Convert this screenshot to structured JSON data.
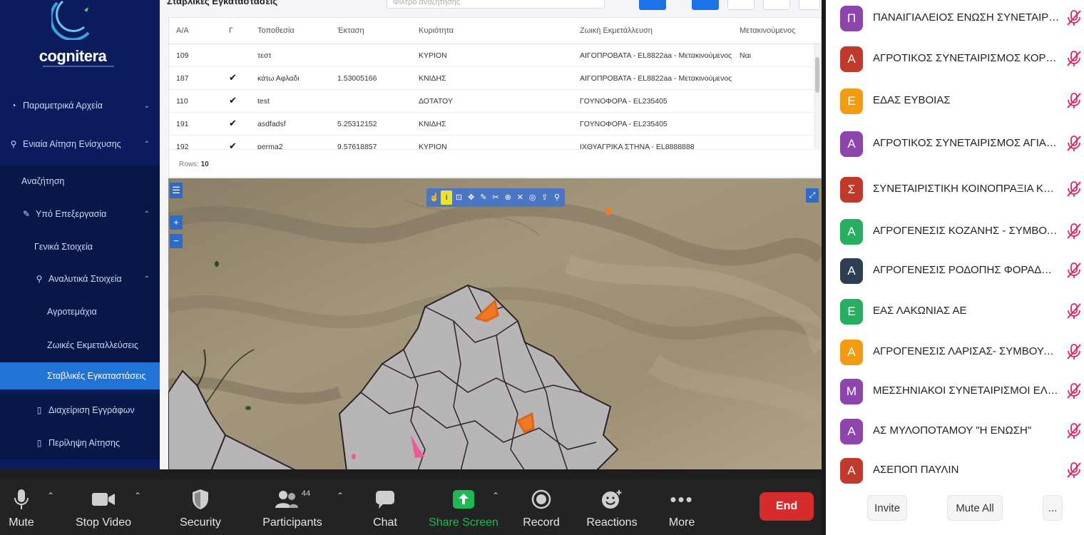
{
  "app": {
    "logo_text": "cognitera",
    "nav": [
      {
        "label": "Παραμετρικά Αρχεία",
        "icon": "settings-icon"
      },
      {
        "label": "Ενιαία Αίτηση Ενίσχυσης",
        "icon": "user-icon"
      },
      {
        "label": "Αναζήτηση"
      },
      {
        "label": "Υπό Επεξεργασία",
        "icon": "pencil-icon"
      },
      {
        "label": "Γενικά Στοιχεία"
      },
      {
        "label": "Αναλυτικά Στοιχεία",
        "icon": "user-icon"
      },
      {
        "label": "Αγροτεμάχια"
      },
      {
        "label": "Ζωικές Εκμεταλλεύσεις"
      },
      {
        "label": "Σταβλικές Εγκαταστάσεις"
      },
      {
        "label": "Διαχείριση Εγγράφων",
        "icon": "document-icon"
      },
      {
        "label": "Περίληψη Αίτησης",
        "icon": "document-icon"
      }
    ],
    "main_title": "Σταβλικές Εγκαταστάσεις",
    "filter_placeholder": "Φίλτρο αναζήτησης",
    "grid": {
      "columns": [
        "Α/Α",
        "Γ",
        "Τοποθεσία",
        "Έκταση",
        "Κυριότητα",
        "Ζωική Εκμετάλλευση",
        "Μετακινούμενος"
      ],
      "rows": [
        {
          "aa": "109",
          "g": "",
          "topo": "τεστ",
          "ektasi": "",
          "kyr": "ΚΥΡΙΟΝ",
          "zoiki": "ΑΙΓΟΠΡΟΒΑΤΑ - EL8822aa - Μετακινούμενος",
          "met": "Ναι"
        },
        {
          "aa": "187",
          "g": "✔",
          "topo": "κάτω Αφλαδι",
          "ektasi": "1.53005166",
          "kyr": "ΚΝΙΔΗΣ",
          "zoiki": "ΑΙΓΟΠΡΟΒΑΤΑ - EL8822aa - Μετακινούμενος",
          "met": ""
        },
        {
          "aa": "110",
          "g": "✔",
          "topo": "test",
          "ektasi": "",
          "kyr": "ΔΟΤΑΤΟΥ",
          "zoiki": "ΓΟΥΝΟΦΟΡΑ - EL235405",
          "met": ""
        },
        {
          "aa": "191",
          "g": "✔",
          "topo": "asdfadsf",
          "ektasi": "5.25312152",
          "kyr": "ΚΝΙΔΗΣ",
          "zoiki": "ΓΟΥΝΟΦΟΡΑ - EL235405",
          "met": ""
        },
        {
          "aa": "192",
          "g": "✔",
          "topo": "perma2",
          "ektasi": "9.57618857",
          "kyr": "ΚΥΡΙΟΝ",
          "zoiki": "ΙΧΘΥΑΓΡΙΚΑ ΣΤΗΝΑ - EL8888888",
          "met": ""
        }
      ],
      "footer_label": "Rows:",
      "footer_count": "10"
    }
  },
  "zoom": {
    "controls": {
      "mute": "Mute",
      "stop_video": "Stop Video",
      "security": "Security",
      "participants": "Participants",
      "participants_count": "44",
      "chat": "Chat",
      "share_screen": "Share Screen",
      "record": "Record",
      "reactions": "Reactions",
      "more": "More",
      "end": "End"
    },
    "participants": [
      {
        "initial": "Π",
        "name": "ΠΑΝΑΙΓΙΑΛΕΙΟΣ ΕΝΩΣΗ ΣΥΝΕΤΑΙΡΙΣ...",
        "color": "#8e44ad"
      },
      {
        "initial": "Α",
        "name": "ΑΓΡΟΤΙΚΟΣ ΣΥΝΕΤΑΙΡΙΣΜΟΣ ΚΟΡΥΦ...",
        "color": "#c0392b"
      },
      {
        "initial": "Ε",
        "name": "ΕΔΑΣ ΕΥΒΟΙΑΣ",
        "color": "#f39c12"
      },
      {
        "initial": "Α",
        "name": "ΑΓΡΟΤΙΚΟΣ ΣΥΝΕΤΑΙΡΙΣΜΟΣ ΑΓΙΑΣ Μ...",
        "color": "#8e44ad"
      },
      {
        "initial": "Σ",
        "name": "ΣΥΝΕΤΑΙΡΙΣΤΙΚΗ ΚΟΙΝΟΠΡΑΞΙΑ ΚΕΡΚ...",
        "color": "#c0392b"
      },
      {
        "initial": "Α",
        "name": "ΑΓΡΟΓΕΝΕΣΙΣ ΚΟΖΑΝΗΣ - ΣΥΜΒΟΥΛ...",
        "color": "#27ae60"
      },
      {
        "initial": "Α",
        "name": "ΑΓΡΟΓΕΝΕΣΙΣ ΡΟΔΟΠΗΣ ΦΟΡΑΔΟΥΛ...",
        "color": "#2c3e50"
      },
      {
        "initial": "Ε",
        "name": "ΕΑΣ ΛΑΚΩΝΙΑΣ ΑΕ",
        "color": "#27ae60"
      },
      {
        "initial": "Α",
        "name": "ΑΓΡΟΓΕΝΕΣΙΣ ΛΑΡΙΣΑΣ- ΣΥΜΒΟΥΛΕΥ...",
        "color": "#f39c12"
      },
      {
        "initial": "Μ",
        "name": "ΜΕΣΣΗΝΙΑΚΟΙ ΣΥΝΕΤΑΙΡΙΣΜΟΙ ΕΛΑΙ...",
        "color": "#8e44ad"
      },
      {
        "initial": "Α",
        "name": "ΑΣ ΜΥΛΟΠΟΤΑΜΟΥ \"Η ΕΝΩΣΗ\"",
        "color": "#8e44ad"
      },
      {
        "initial": "Α",
        "name": "ΑΣΕΠΟΠ ΠΑΥΛΙΝ",
        "color": "#c0392b"
      }
    ],
    "panel_buttons": {
      "invite": "Invite",
      "mute_all": "Mute All",
      "more": "..."
    },
    "colors": {
      "end": "#d72c2c",
      "share": "#1db954",
      "mute_icon": "#e0245e",
      "nav_active": "#1f74d6"
    }
  }
}
